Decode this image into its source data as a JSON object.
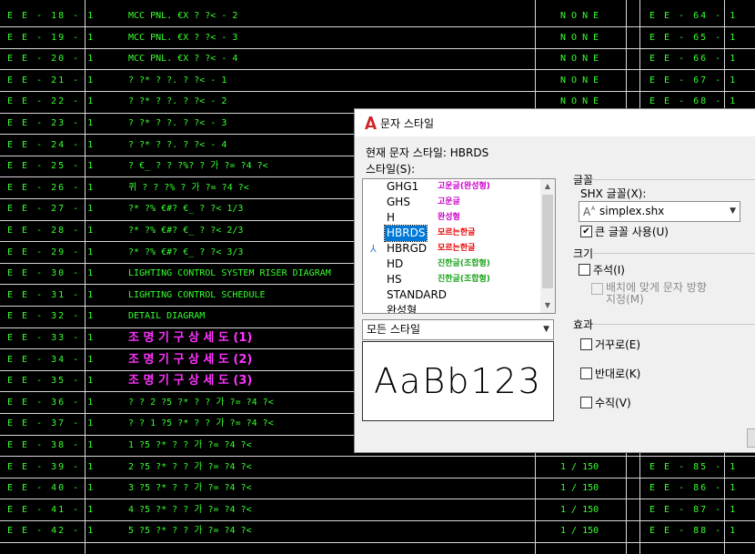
{
  "drawing": {
    "rows": [
      {
        "no": "E E - 18 - 1",
        "desc": "MCC  PNL.  €X ? ?< - 2",
        "style": "green",
        "scale": "N O N E",
        "ref": "E E - 64 - 1"
      },
      {
        "no": "E E - 19 - 1",
        "desc": "MCC  PNL.  €X ? ?< - 3",
        "style": "green",
        "scale": "N O N E",
        "ref": "E E - 65 - 1"
      },
      {
        "no": "E E - 20 - 1",
        "desc": "MCC  PNL.  €X ? ?< - 4",
        "style": "green",
        "scale": "N O N E",
        "ref": "E E - 66 - 1"
      },
      {
        "no": "E E - 21 - 1",
        "desc": "? ?* ?  ?. ? ?< - 1",
        "style": "green",
        "scale": "N O N E",
        "ref": "E E - 67 - 1"
      },
      {
        "no": "E E - 22 - 1",
        "desc": "? ?* ?  ?. ? ?< - 2",
        "style": "green",
        "scale": "N O N E",
        "ref": "E E - 68 - 1"
      },
      {
        "no": "E E - 23 - 1",
        "desc": "? ?* ?  ?. ? ?< - 3",
        "style": "green",
        "scale": "",
        "ref": ""
      },
      {
        "no": "E E - 24 - 1",
        "desc": "? ?* ?  ?. ? ?< - 4",
        "style": "green",
        "scale": "",
        "ref": ""
      },
      {
        "no": "E E - 25 - 1",
        "desc": "? €_ ?  ? ?%? ?  가  ?= ?4 ?<",
        "style": "green",
        "scale": "",
        "ref": ""
      },
      {
        "no": "E E - 26 - 1",
        "desc": "퀴 ?  ? ?%  ?  가  ?= ?4 ?<",
        "style": "green",
        "scale": "",
        "ref": ""
      },
      {
        "no": "E E - 27 - 1",
        "desc": "?* ?%  €#?  €_ ? ?<   1/3",
        "style": "green",
        "scale": "",
        "ref": ""
      },
      {
        "no": "E E - 28 - 1",
        "desc": "?* ?%  €#?  €_ ? ?<   2/3",
        "style": "green",
        "scale": "",
        "ref": ""
      },
      {
        "no": "E E - 29 - 1",
        "desc": "?* ?%  €#?  €_ ? ?<   3/3",
        "style": "green",
        "scale": "",
        "ref": ""
      },
      {
        "no": "E E - 30 - 1",
        "desc": "LIGHTING  CONTROL  SYSTEM  RISER  DIAGRAM",
        "style": "green",
        "scale": "",
        "ref": ""
      },
      {
        "no": "E E - 31 - 1",
        "desc": "LIGHTING  CONTROL  SCHEDULE",
        "style": "green",
        "scale": "",
        "ref": ""
      },
      {
        "no": "E E - 32 - 1",
        "desc": "DETAIL  DIAGRAM",
        "style": "green",
        "scale": "",
        "ref": ""
      },
      {
        "no": "E E - 33 - 1",
        "desc": "조 명 기 구 상 세 도  (1)",
        "style": "pink",
        "scale": "",
        "ref": ""
      },
      {
        "no": "E E - 34 - 1",
        "desc": "조 명 기 구 상 세 도  (2)",
        "style": "pink",
        "scale": "",
        "ref": ""
      },
      {
        "no": "E E - 35 - 1",
        "desc": "조 명 기 구 상 세 도  (3)",
        "style": "pink",
        "scale": "",
        "ref": ""
      },
      {
        "no": "E E - 36 - 1",
        "desc": "? ? 2 ?5      ?* ?  ?  가  ?= ?4 ?<",
        "style": "green",
        "scale": "",
        "ref": ""
      },
      {
        "no": "E E - 37 - 1",
        "desc": "? ? 1 ?5      ?* ?  ?  가  ?= ?4 ?<",
        "style": "green",
        "scale": "",
        "ref": ""
      },
      {
        "no": "E E - 38 - 1",
        "desc": "1      ?5      ?* ?  ?  가  ?= ?4 ?<",
        "style": "green",
        "scale": "",
        "ref": ""
      },
      {
        "no": "E E - 39 - 1",
        "desc": "2      ?5      ?* ?  ?  가  ?= ?4 ?<",
        "style": "green",
        "scale": "1 / 150",
        "ref": "E E - 85 - 1"
      },
      {
        "no": "E E - 40 - 1",
        "desc": "3      ?5      ?* ?  ?  가  ?= ?4 ?<",
        "style": "green",
        "scale": "1 / 150",
        "ref": "E E - 86 - 1"
      },
      {
        "no": "E E - 41 - 1",
        "desc": "4      ?5      ?* ?  ?  가  ?= ?4 ?<",
        "style": "green",
        "scale": "1 / 150",
        "ref": "E E - 87 - 1"
      },
      {
        "no": "E E - 42 - 1",
        "desc": "5      ?5      ?* ?  ?  가  ?= ?4 ?<",
        "style": "green",
        "scale": "1 / 150",
        "ref": "E E - 88 - 1"
      }
    ]
  },
  "dialog": {
    "title": "문자 스타일",
    "current_style_label": "현재 문자 스타일: HBRDS",
    "styles_label": "스타일(S):",
    "styles": [
      {
        "name": "GHG1",
        "font": "고운글(완성형)",
        "font_color": "#cc00cc",
        "selected": false,
        "annotative": false
      },
      {
        "name": "GHS",
        "font": "고운글",
        "font_color": "#cc00cc",
        "selected": false,
        "annotative": false
      },
      {
        "name": "H",
        "font": "완성형",
        "font_color": "#cc00cc",
        "selected": false,
        "annotative": false
      },
      {
        "name": "HBRDS",
        "font": "모르는한글",
        "font_color": "#e60000",
        "selected": true,
        "annotative": false
      },
      {
        "name": "HBRGD",
        "font": "모르는한글",
        "font_color": "#e60000",
        "selected": false,
        "annotative": true
      },
      {
        "name": "HD",
        "font": "진한글(조합형)",
        "font_color": "#1aa31a",
        "selected": false,
        "annotative": false
      },
      {
        "name": "HS",
        "font": "진한글(조합형)",
        "font_color": "#1aa31a",
        "selected": false,
        "annotative": false
      },
      {
        "name": "STANDARD",
        "font": "",
        "font_color": "#000000",
        "selected": false,
        "annotative": false
      },
      {
        "name": "완성형",
        "font": "",
        "font_color": "#000000",
        "selected": false,
        "annotative": false
      }
    ],
    "filter_value": "모든 스타일",
    "preview_text": "AaBb123",
    "font_group": "글꼴",
    "shx_font_label": "SHX 글꼴(X):",
    "shx_font_value": "simplex.shx",
    "big_font_label": "큰 글꼴 사용(U)",
    "big_font_checked": true,
    "size_group": "크기",
    "annotative_label": "주석(I)",
    "annotative_checked": false,
    "match_orientation_line1": "배치에 맞게 문자 방향",
    "match_orientation_line2": "지정(M)",
    "effects_group": "효과",
    "upside_down_label": "거꾸로(E)",
    "backwards_label": "반대로(K)",
    "vertical_label": "수직(V)"
  }
}
